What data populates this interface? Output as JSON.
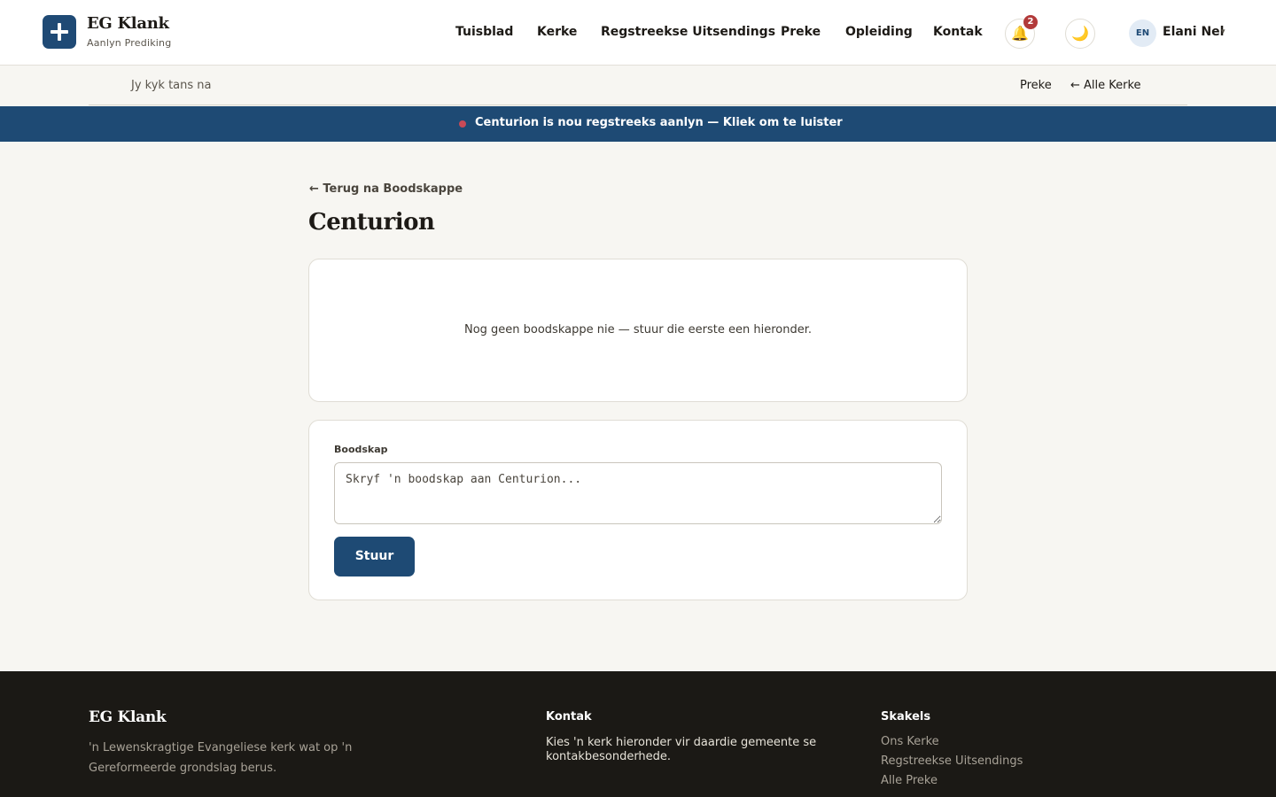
{
  "header": {
    "brand_title": "EG Klank",
    "brand_subtitle": "Aanlyn Prediking",
    "nav": [
      "Tuisblad",
      "Kerke",
      "Regstreekse Uitsendings",
      "Preke",
      "Opleiding",
      "Kontak"
    ],
    "notifications_count": "2",
    "notification_icon": "bell-icon",
    "theme_icon": "moon-icon",
    "user": {
      "lang": "EN",
      "name": "Elani Nel",
      "caret": "▾"
    }
  },
  "subbar": {
    "now_viewing": "Jy kyk tans na",
    "links": {
      "preke": "Preke",
      "all_churches": "← Alle Kerke"
    }
  },
  "live_banner": {
    "text": "Centurion is nou regstreeks aanlyn — Kliek om te luister"
  },
  "main": {
    "back_link": "← Terug na Boodskappe",
    "title": "Centurion",
    "empty_state": "Nog geen boodskappe nie — stuur die eerste een hieronder.",
    "form": {
      "label": "Boodskap",
      "placeholder": "Skryf 'n boodskap aan Centurion...",
      "submit": "Stuur"
    }
  },
  "footer": {
    "brand": "EG Klank",
    "tagline": "'n Lewenskragtige Evangeliese kerk wat op 'n Gereformeerde grondslag berus.",
    "contact_heading": "Kontak",
    "contact_text": "Kies 'n kerk hieronder vir daardie gemeente se kontakbesonderhede.",
    "links_heading": "Skakels",
    "links": [
      "Ons Kerke",
      "Regstreekse Uitsendings",
      "Alle Preke"
    ]
  },
  "colors": {
    "primary": "#1e4a74",
    "live_dot": "#c94a57",
    "badge": "#b23a3a",
    "footer_bg": "#1b1915",
    "page_bg": "#f7f6f2"
  }
}
